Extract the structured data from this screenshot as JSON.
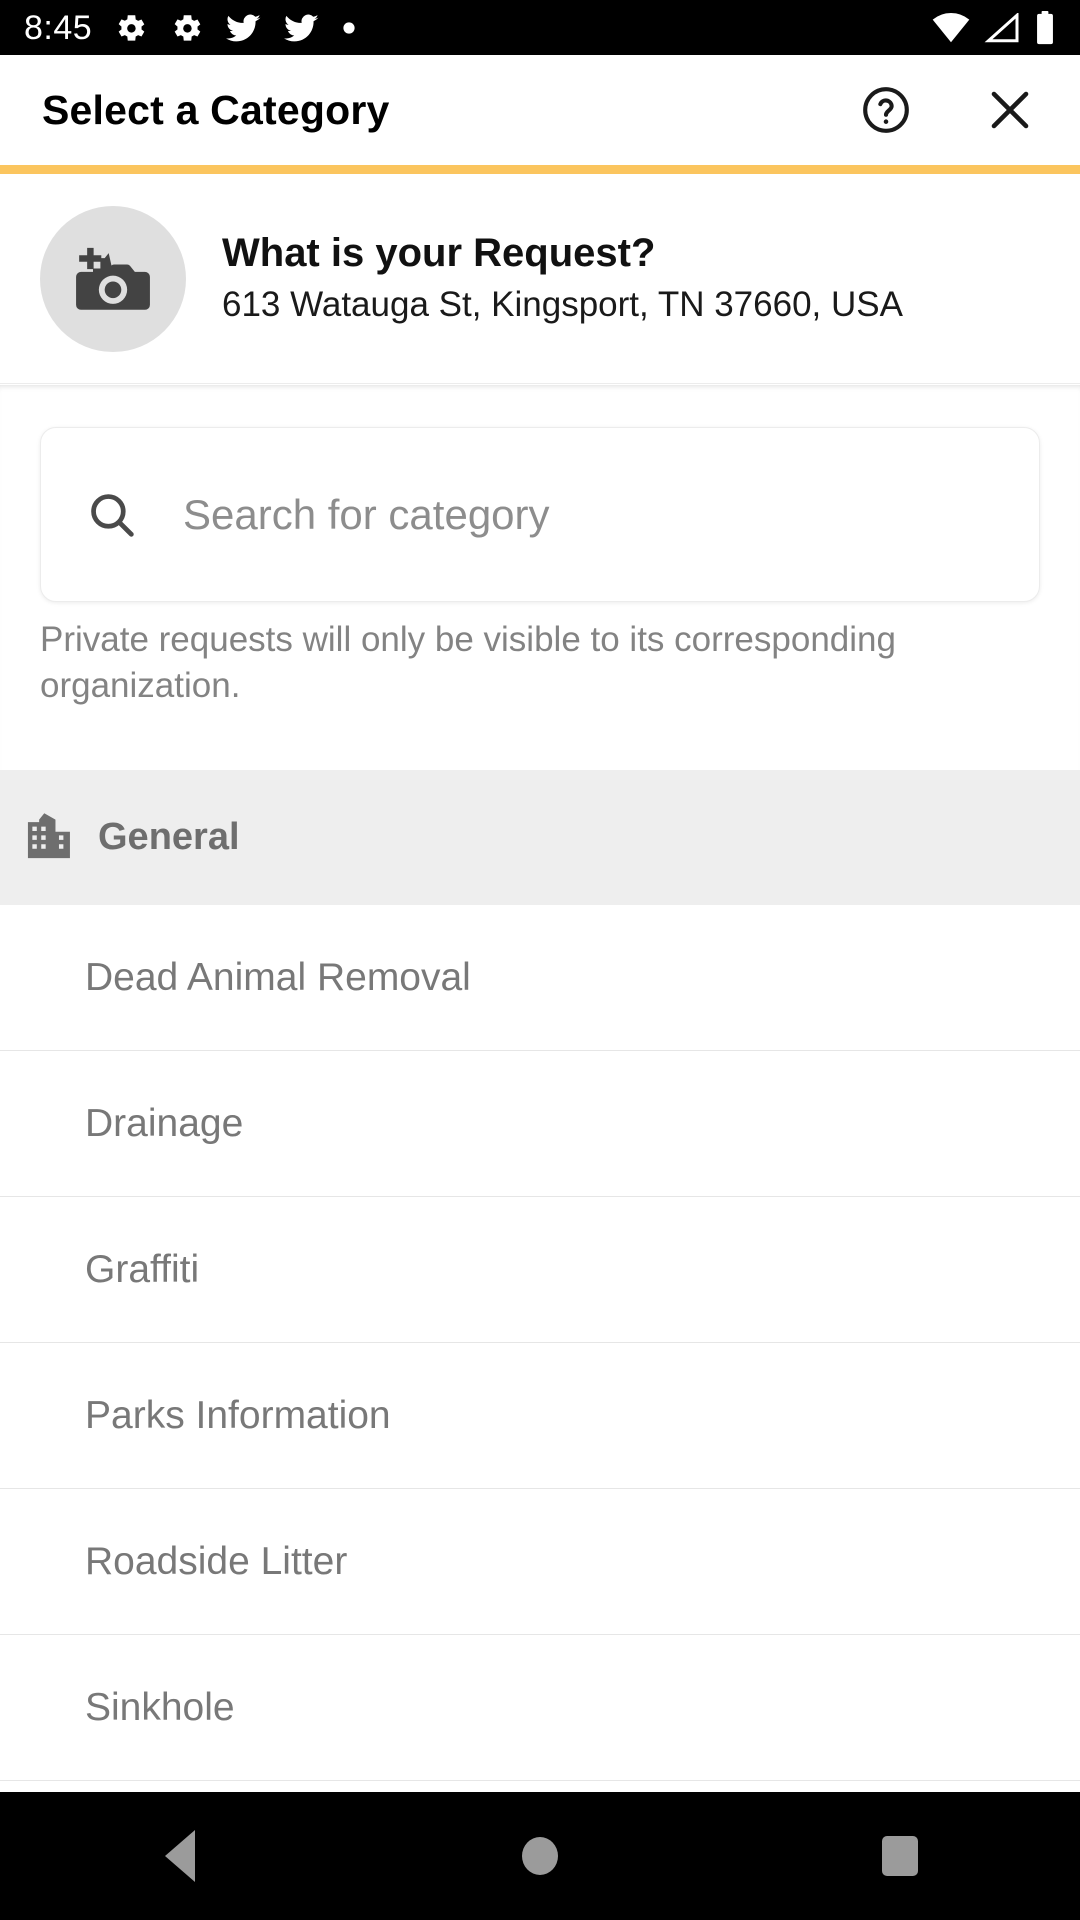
{
  "status_bar": {
    "time": "8:45",
    "left_icons": [
      "gear-icon",
      "gear-icon",
      "bird-icon",
      "bird-icon",
      "dot-icon"
    ],
    "right_icons": [
      "wifi-icon",
      "cellular-signal-icon",
      "battery-icon"
    ]
  },
  "header": {
    "title": "Select a Category",
    "help_icon": "help-circle-icon",
    "close_icon": "close-icon"
  },
  "progress": {
    "color": "#FBC55E"
  },
  "request": {
    "photo_icon": "add-photo-camera-icon",
    "title": "What is your Request?",
    "address": "613 Watauga St, Kingsport, TN 37660, USA"
  },
  "search": {
    "icon": "search-icon",
    "value": "",
    "placeholder": "Search for category"
  },
  "privacy_note": "Private requests will only be visible to its corresponding organization.",
  "groups": [
    {
      "icon": "city-buildings-icon",
      "label": "General",
      "items": [
        {
          "label": "Dead Animal Removal"
        },
        {
          "label": "Drainage"
        },
        {
          "label": "Graffiti"
        },
        {
          "label": "Parks Information"
        },
        {
          "label": "Roadside Litter"
        },
        {
          "label": "Sinkhole"
        }
      ]
    }
  ],
  "nav_bar": {
    "back": "back-triangle-icon",
    "home": "home-circle-icon",
    "recents": "recents-square-icon"
  }
}
